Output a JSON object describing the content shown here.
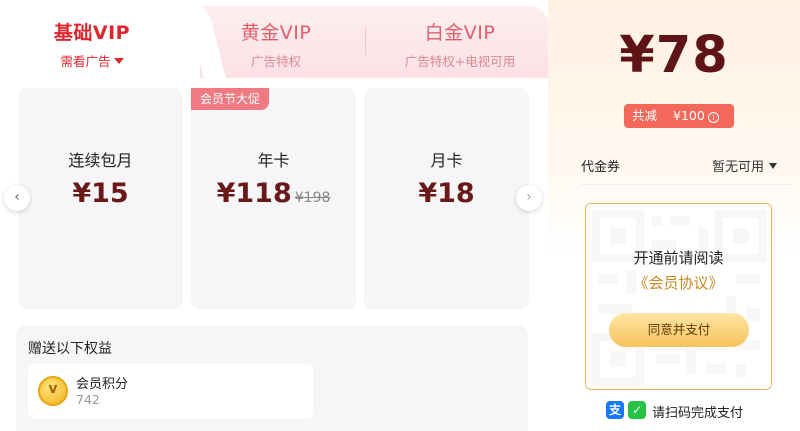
{
  "tabs": [
    {
      "title": "基础VIP",
      "subtitle": "需看广告"
    },
    {
      "title": "黄金VIP",
      "subtitle": "广告特权"
    },
    {
      "title": "白金VIP",
      "subtitle": "广告特权+电视可用"
    }
  ],
  "promo_badge": "会员节大促",
  "plans": [
    {
      "name": "连续包月",
      "price": "¥15"
    },
    {
      "name": "年卡",
      "price": "¥118",
      "original_price": "¥198"
    },
    {
      "name": "月卡",
      "price": "¥18"
    }
  ],
  "benefits": {
    "heading": "赠送以下权益",
    "items": [
      {
        "icon": "v",
        "name": "会员积分",
        "value": "742"
      }
    ]
  },
  "payment": {
    "total": "¥78",
    "discount_label": "共减",
    "discount_amount": "¥100",
    "info_icon": "i",
    "coupon_label": "代金券",
    "coupon_value": "暂无可用",
    "qr_title": "开通前请阅读",
    "qr_link": "《会员协议》",
    "agree_button": "同意并支付",
    "scan_hint": "请扫码完成支付",
    "alipay_icon_text": "支",
    "wechat_icon_text": "✓"
  },
  "colors": {
    "accent_red": "#e0262d",
    "price_dark": "#6a1919",
    "gold": "#e9b262",
    "discount_bg": "#f2685b"
  }
}
